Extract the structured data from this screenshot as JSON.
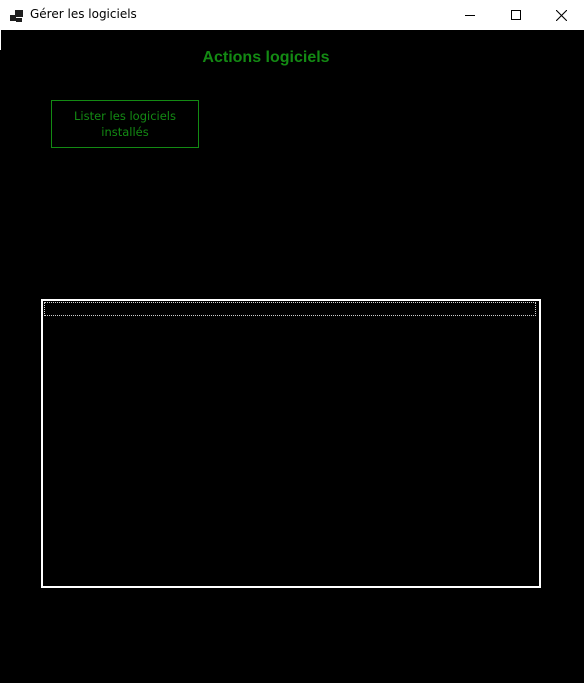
{
  "window": {
    "title": "Gérer les logiciels",
    "icon": "app-window-icon",
    "controls": [
      "minimize-icon",
      "maximize-icon",
      "close-icon"
    ]
  },
  "main": {
    "heading": "Actions logiciels",
    "list_button_label": "Lister les logiciels installés",
    "software_list": []
  },
  "colors": {
    "background": "#000000",
    "accent": "#138a13",
    "listbox_border": "#ffffff"
  }
}
